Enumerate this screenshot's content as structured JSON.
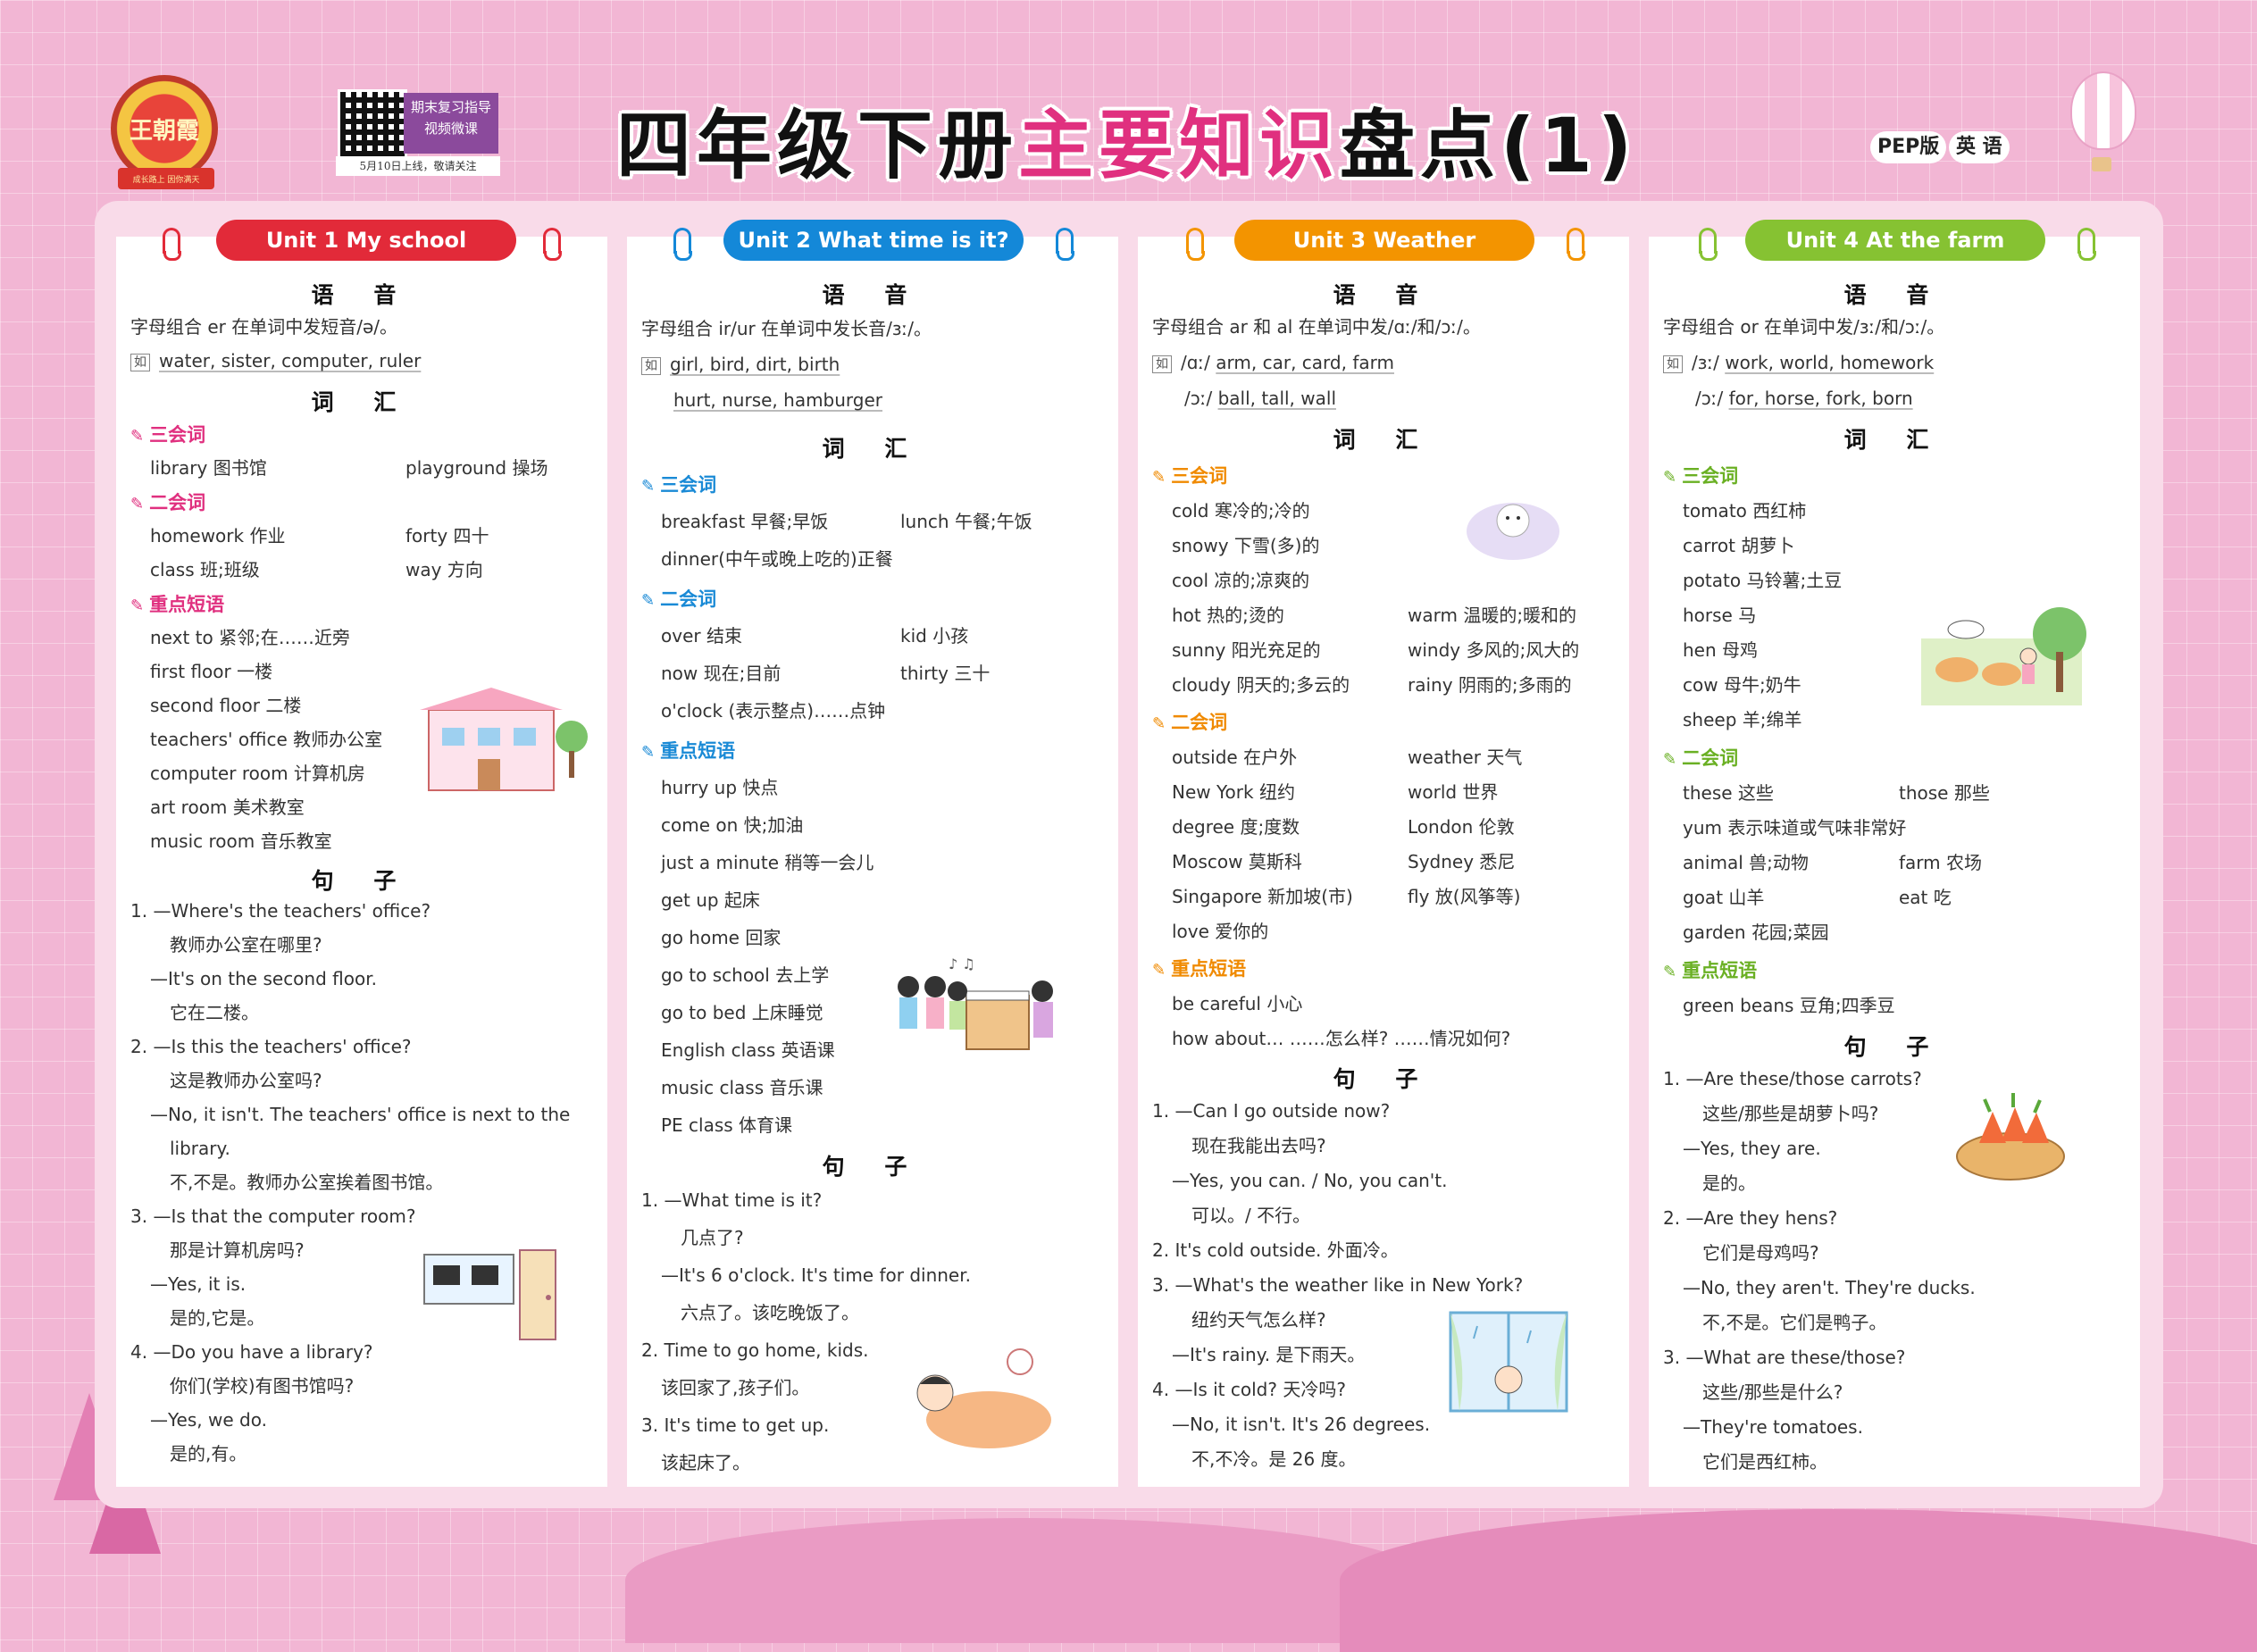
{
  "header": {
    "logo_text": "王朝霞",
    "logo_ribbon": "成长路上 因你满天",
    "qr_box_line1": "期末复习指导",
    "qr_box_line2": "视频微课",
    "qr_caption": "5月10日上线，敬请关注",
    "title_pre": "四年级下册",
    "title_hl": "主要知识",
    "title_post": "盘点(1)",
    "tag_edition": "PEP版",
    "tag_subject": "英 语"
  },
  "unit1": {
    "title": "Unit 1  My school",
    "phonics_heading": "语  音",
    "phonics_rule": "字母组合 er 在单词中发短音/ə/。",
    "example_label": "如",
    "phonics_examples": "water, sister, computer, ruler",
    "vocab_heading": "词  汇",
    "cat_sanhui": "三会词",
    "w1a": "library 图书馆",
    "w1b": "playground 操场",
    "cat_erhui": "二会词",
    "w2a": "homework 作业",
    "w2b": "forty 四十",
    "w3a": "class 班;班级",
    "w3b": "way 方向",
    "cat_phrases": "重点短语",
    "p1": "next to 紧邻;在……近旁",
    "p2": "first floor 一楼",
    "p3": "second floor 二楼",
    "p4": "teachers' office 教师办公室",
    "p5": "computer room 计算机房",
    "p6": "art room 美术教室",
    "p7": "music room 音乐教室",
    "sent_heading": "句  子",
    "s1": "1. —Where's the teachers' office?",
    "s2": "教师办公室在哪里?",
    "s3": "—It's on the second floor.",
    "s4": "它在二楼。",
    "s5": "2. —Is this the teachers' office?",
    "s6": "这是教师办公室吗?",
    "s7": "—No, it isn't. The teachers' office is next to the",
    "s8": "library.",
    "s9": "不,不是。教师办公室挨着图书馆。",
    "s10": "3. —Is that the computer room?",
    "s11": "那是计算机房吗?",
    "s12": "—Yes, it is.",
    "s13": "是的,它是。",
    "s14": "4. —Do you have a library?",
    "s15": "你们(学校)有图书馆吗?",
    "s16": "—Yes, we do.",
    "s17": "是的,有。"
  },
  "unit2": {
    "title": "Unit 2  What time is it?",
    "phonics_heading": "语  音",
    "phonics_rule": "字母组合 ir/ur 在单词中发长音/ɜː/。",
    "example_label": "如",
    "ex1": "girl, bird, dirt, birth",
    "ex2": "hurt, nurse, hamburger",
    "vocab_heading": "词  汇",
    "cat_sanhui": "三会词",
    "w1a": "breakfast 早餐;早饭",
    "w1b": "lunch 午餐;午饭",
    "w2": "dinner(中午或晚上吃的)正餐",
    "cat_erhui": "二会词",
    "w3a": "over 结束",
    "w3b": "kid 小孩",
    "w4a": "now 现在;目前",
    "w4b": "thirty 三十",
    "w5": "o'clock (表示整点)……点钟",
    "cat_phrases": "重点短语",
    "p1": "hurry up 快点",
    "p2": "come on 快;加油",
    "p3": "just a minute 稍等一会儿",
    "p4": "get up 起床",
    "p5": "go home 回家",
    "p6": "go to school 去上学",
    "p7": "go to bed 上床睡觉",
    "p8": "English class 英语课",
    "p9": "music class 音乐课",
    "p10": "PE class 体育课",
    "sent_heading": "句  子",
    "s1": "1. —What time is it?",
    "s2": "几点了?",
    "s3": "—It's 6 o'clock. It's time for dinner.",
    "s4": "六点了。该吃晚饭了。",
    "s5": "2. Time to go home, kids.",
    "s6": "该回家了,孩子们。",
    "s7": "3. It's time to get up.",
    "s8": "该起床了。"
  },
  "unit3": {
    "title": "Unit 3  Weather",
    "phonics_heading": "语  音",
    "phonics_rule": "字母组合 ar 和 al 在单词中发/ɑː/和/ɔː/。",
    "example_label": "如",
    "ex1_ipa": "/ɑː/",
    "ex1": "arm, car, card, farm",
    "ex2_ipa": "/ɔː/",
    "ex2": "ball, tall, wall",
    "vocab_heading": "词  汇",
    "cat_sanhui": "三会词",
    "w1": "cold 寒冷的;冷的",
    "w2": "snowy 下雪(多)的",
    "w3": "cool 凉的;凉爽的",
    "w4a": "hot 热的;烫的",
    "w4b": "warm 温暖的;暖和的",
    "w5a": "sunny 阳光充足的",
    "w5b": "windy 多风的;风大的",
    "w6a": "cloudy 阴天的;多云的",
    "w6b": "rainy 阴雨的;多雨的",
    "cat_erhui": "二会词",
    "w7a": "outside 在户外",
    "w7b": "weather 天气",
    "w8a": "New York 纽约",
    "w8b": "world 世界",
    "w9a": "degree 度;度数",
    "w9b": "London 伦敦",
    "w10a": "Moscow 莫斯科",
    "w10b": "Sydney 悉尼",
    "w11a": "Singapore 新加坡(市)",
    "w11b": "fly 放(风筝等)",
    "w12": "love 爱你的",
    "cat_phrases": "重点短语",
    "p1": "be careful 小心",
    "p2": "how about… ……怎么样? ……情况如何?",
    "sent_heading": "句  子",
    "s1": "1. —Can I go outside now?",
    "s2": "现在我能出去吗?",
    "s3": "—Yes, you can. / No, you can't.",
    "s4": "可以。/ 不行。",
    "s5": "2. It's cold outside. 外面冷。",
    "s6": "3. —What's the weather like in New York?",
    "s7": "纽约天气怎么样?",
    "s8": "—It's rainy. 是下雨天。",
    "s9": "4. —Is it cold?  天冷吗?",
    "s10": "—No, it isn't. It's 26 degrees.",
    "s11": "不,不冷。是 26 度。"
  },
  "unit4": {
    "title": "Unit 4  At the farm",
    "phonics_heading": "语  音",
    "phonics_rule": "字母组合 or 在单词中发/ɜː/和/ɔː/。",
    "example_label": "如",
    "ex1_ipa": "/ɜː/",
    "ex1": "work, world, homework",
    "ex2_ipa": "/ɔː/",
    "ex2": "for, horse, fork, born",
    "vocab_heading": "词  汇",
    "cat_sanhui": "三会词",
    "w1": "tomato 西红柿",
    "w2": "carrot 胡萝卜",
    "w3": "potato 马铃薯;土豆",
    "w4": "horse 马",
    "w5": "hen 母鸡",
    "w6": "cow 母牛;奶牛",
    "w7": "sheep 羊;绵羊",
    "cat_erhui": "二会词",
    "w8a": "these 这些",
    "w8b": "those 那些",
    "w9": "yum 表示味道或气味非常好",
    "w10a": "animal 兽;动物",
    "w10b": "farm 农场",
    "w11a": "goat 山羊",
    "w11b": "eat 吃",
    "w12": "garden 花园;菜园",
    "cat_phrases": "重点短语",
    "p1": "green beans 豆角;四季豆",
    "sent_heading": "句  子",
    "s1": "1. —Are these/those carrots?",
    "s2": "这些/那些是胡萝卜吗?",
    "s3": "—Yes, they are.",
    "s4": "是的。",
    "s5": "2. —Are they hens?",
    "s6": "它们是母鸡吗?",
    "s7": "—No, they aren't. They're ducks.",
    "s8": "不,不是。它们是鸭子。",
    "s9": "3. —What are these/those?",
    "s10": "这些/那些是什么?",
    "s11": "—They're tomatoes.",
    "s12": "它们是西红柿。"
  }
}
